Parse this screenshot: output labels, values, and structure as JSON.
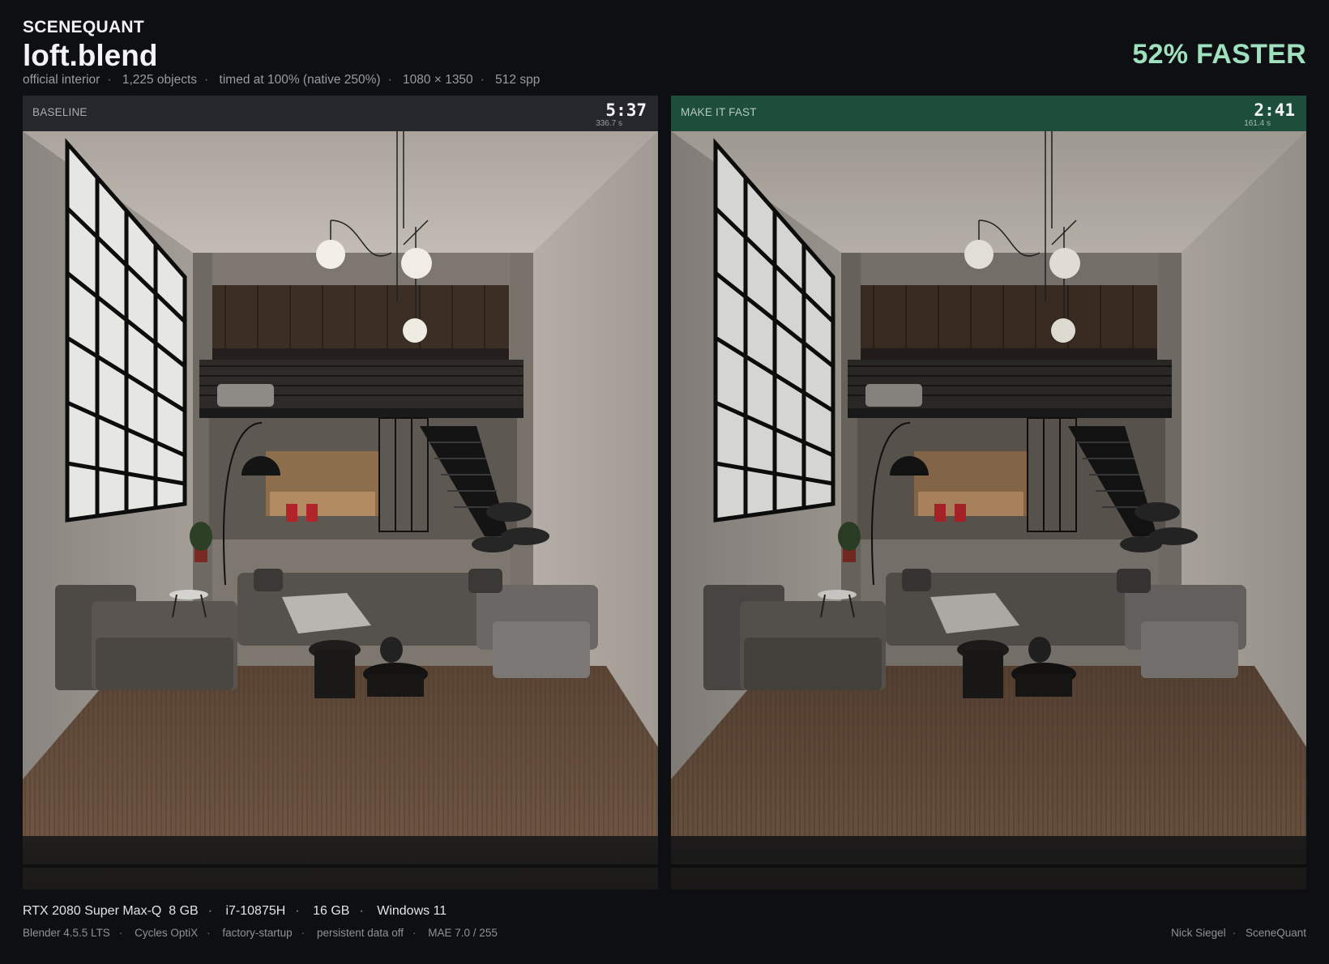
{
  "header": {
    "brand": "SCENEQUANT",
    "title": "loft.blend",
    "meta": [
      "official interior",
      "1,225 objects",
      "timed at 100% (native 250%)",
      "1080 × 1350",
      "512 spp"
    ],
    "speedup": "52% FASTER"
  },
  "panels": {
    "baseline": {
      "label": "BASELINE",
      "time": "5:37",
      "seconds": "336.7 s"
    },
    "fast": {
      "label": "MAKE IT FAST",
      "time": "2:41",
      "seconds": "161.4 s"
    }
  },
  "footer": {
    "hardware": [
      "RTX 2080 Super Max-Q  8 GB",
      "i7-10875H",
      "16 GB",
      "Windows 11"
    ],
    "software": [
      "Blender 4.5.5 LTS",
      "Cycles OptiX",
      "factory-startup",
      "persistent data off",
      "MAE 7.0 / 255"
    ],
    "credit": [
      "Nick Siegel",
      "SceneQuant"
    ]
  },
  "colors": {
    "background": "#0e0f12",
    "accent_green": "#9fe0bf",
    "fast_header": "#1d4e3b",
    "baseline_header": "#26272c"
  }
}
